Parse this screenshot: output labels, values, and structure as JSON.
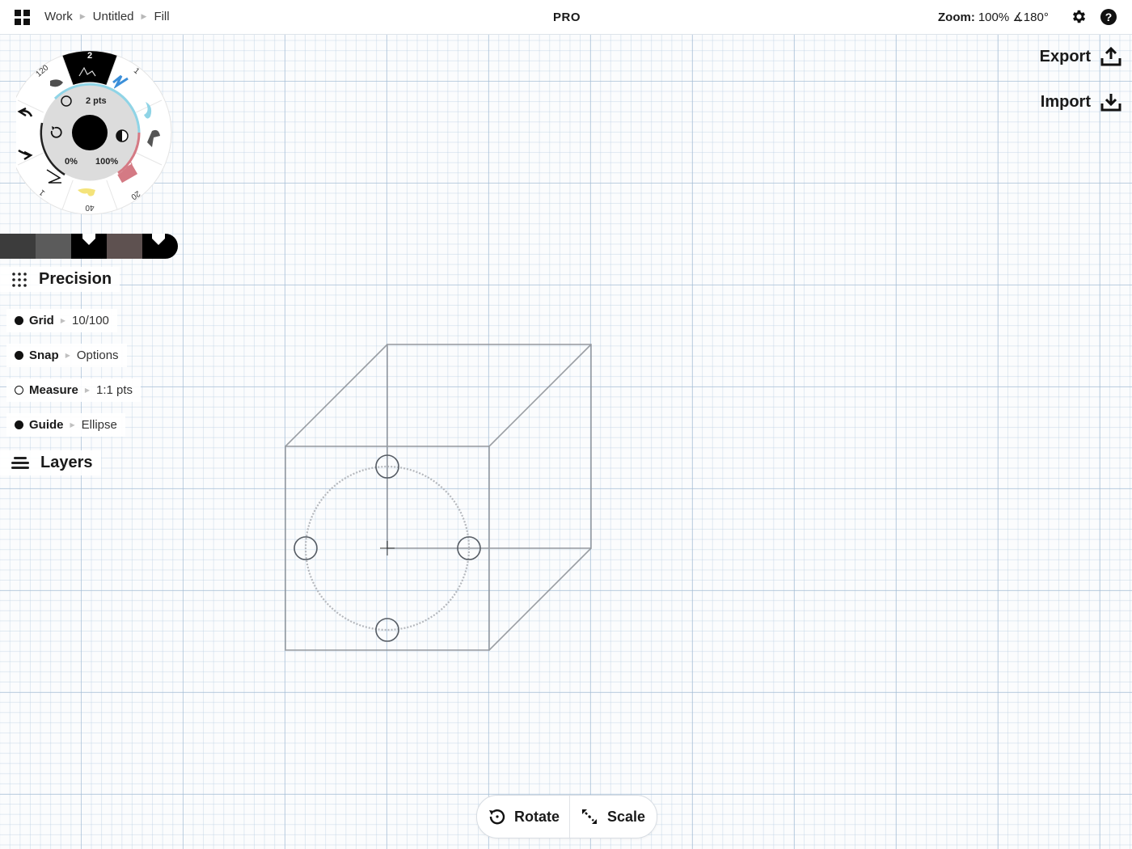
{
  "topbar": {
    "breadcrumbs": [
      "Work",
      "Untitled",
      "Fill"
    ],
    "center_label": "PRO",
    "zoom_label": "Zoom:",
    "zoom_value": "100% ∡180°",
    "settings_icon": "gear-icon",
    "help_icon": "?"
  },
  "actions": {
    "export_label": "Export",
    "import_label": "Import"
  },
  "tool_wheel": {
    "size_label": "2 pts",
    "opacity_min": "0%",
    "opacity_max": "100%",
    "tool_sizes": [
      "2",
      "1",
      "20",
      "40",
      "1",
      "120"
    ],
    "current_color": "#000000"
  },
  "swatches": [
    "#3c3c3c",
    "#5b5b5b",
    "#4a4a4a",
    "#000000",
    "#5e5150",
    "#4d4d4d"
  ],
  "precision": {
    "title": "Precision",
    "rows": [
      {
        "name": "Grid",
        "value": "10/100",
        "on": true
      },
      {
        "name": "Snap",
        "value": "Options",
        "on": true
      },
      {
        "name": "Measure",
        "value": "1:1 pts",
        "on": false
      },
      {
        "name": "Guide",
        "value": "Ellipse",
        "on": true
      }
    ]
  },
  "layers": {
    "title": "Layers"
  },
  "bottom_toolbar": {
    "rotate_label": "Rotate",
    "scale_label": "Scale"
  }
}
